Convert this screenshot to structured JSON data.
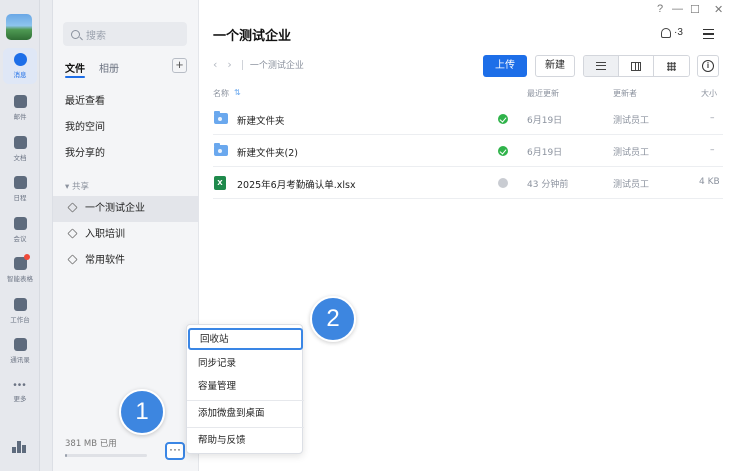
{
  "rail": {
    "items": [
      {
        "label": "消息",
        "icon": "chat-icon"
      },
      {
        "label": "邮件",
        "icon": "mail-icon"
      },
      {
        "label": "文档",
        "icon": "document-icon"
      },
      {
        "label": "日程",
        "icon": "calendar-icon"
      },
      {
        "label": "会议",
        "icon": "meeting-icon"
      },
      {
        "label": "智能表格",
        "icon": "smart-sheet-icon"
      },
      {
        "label": "工作台",
        "icon": "workbench-icon"
      },
      {
        "label": "通讯录",
        "icon": "contacts-icon"
      },
      {
        "label": "更多",
        "icon": "more-icon"
      }
    ],
    "active_index": 0
  },
  "sidebar": {
    "search_placeholder": "搜索",
    "tabs": [
      "文件",
      "相册"
    ],
    "add_label": "+",
    "nav": [
      "最近查看",
      "我的空间",
      "我分享的"
    ],
    "section_title": "▾ 共享",
    "shared": [
      "一个测试企业",
      "入职培训",
      "常用软件"
    ],
    "storage": "381 MB 已用",
    "storage_fraction": 0.03,
    "more_label": "···"
  },
  "main": {
    "title": "一个测试企业",
    "members": "·3",
    "breadcrumb": "一个测试企业",
    "upload": "上传",
    "new": "新建",
    "info": "i",
    "columns": {
      "name": "名称",
      "sort": "⇅",
      "updated": "最近更新",
      "updater": "更新者",
      "size": "大小"
    },
    "rows": [
      {
        "type": "folder",
        "name": "新建文件夹",
        "status": "synced",
        "updated": "6月19日",
        "updater": "测试员工",
        "size": "–"
      },
      {
        "type": "folder",
        "name": "新建文件夹(2)",
        "status": "synced",
        "updated": "6月19日",
        "updater": "测试员工",
        "size": "–"
      },
      {
        "type": "xlsx",
        "name": "2025年6月考勤确认单.xlsx",
        "status": "cloud",
        "updated": "43 分钟前",
        "updater": "测试员工",
        "size": "4 KB"
      }
    ]
  },
  "popup": {
    "items": [
      "回收站",
      "同步记录",
      "容量管理",
      "添加微盘到桌面",
      "帮助与反馈"
    ]
  },
  "callouts": [
    "1",
    "2"
  ],
  "window_controls": [
    "?",
    "—",
    "☐",
    "✕"
  ]
}
